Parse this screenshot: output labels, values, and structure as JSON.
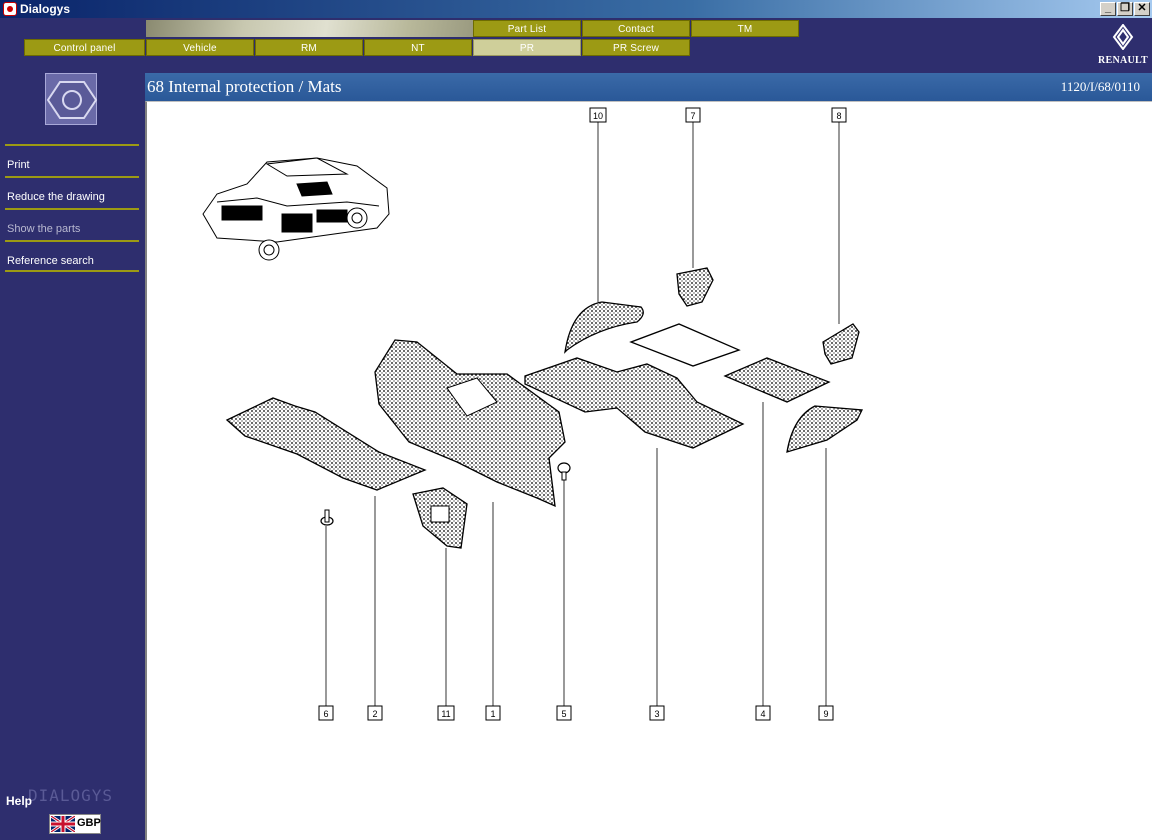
{
  "window": {
    "title": "Dialogys",
    "minimize": "_",
    "restore": "❐",
    "close": "✕"
  },
  "nav": {
    "top_row": [
      {
        "label": "Part List"
      },
      {
        "label": "Contact"
      },
      {
        "label": "TM"
      }
    ],
    "bottom_row": [
      {
        "label": "Control panel"
      },
      {
        "label": "Vehicle"
      },
      {
        "label": "RM"
      },
      {
        "label": "NT"
      },
      {
        "label": "PR",
        "active": true
      },
      {
        "label": "PR Screw"
      }
    ]
  },
  "brand": {
    "logo_text": "RENAULT"
  },
  "sidebar": {
    "items": [
      {
        "label": "Print"
      },
      {
        "label": "Reduce the drawing"
      },
      {
        "label": "Show the parts",
        "disabled": true
      },
      {
        "label": "Reference search"
      }
    ],
    "help_label": "Help",
    "watermark": "DIALOGYS",
    "currency": "GBP"
  },
  "header": {
    "title": "68 Internal protection / Mats",
    "reference": "1120/I/68/0110"
  },
  "drawing": {
    "callouts_top": [
      "10",
      "7",
      "8"
    ],
    "callouts_bottom": [
      "6",
      "2",
      "11",
      "1",
      "5",
      "3",
      "4",
      "9"
    ]
  },
  "colors": {
    "sidebar_bg": "#2e2e6e",
    "nav_button": "#9c9a14",
    "nav_active": "#cfcf9a",
    "header_bg": "#2a5898"
  }
}
